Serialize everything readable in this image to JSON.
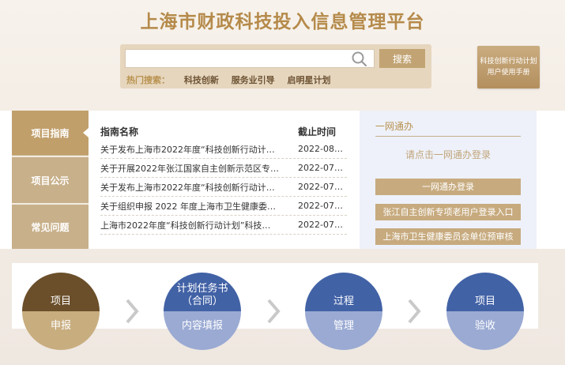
{
  "header": {
    "title": "上海市财政科技投入信息管理平台"
  },
  "search": {
    "placeholder": "",
    "button_label": "搜索",
    "hot_label": "热门搜索：",
    "hot_links": [
      "科技创新",
      "服务业引导",
      "启明星计划"
    ]
  },
  "manual": {
    "line1": "科技创新行动计划",
    "line2": "用户使用手册"
  },
  "tabs": [
    {
      "label": "项目指南",
      "active": true
    },
    {
      "label": "项目公示",
      "active": false
    },
    {
      "label": "常见问题",
      "active": false
    }
  ],
  "guide": {
    "col_name": "指南名称",
    "col_date": "截止时间",
    "rows": [
      {
        "name": "关于发布上海市2022年度“科技创新行动计…",
        "date": "2022-08…"
      },
      {
        "name": "关于开展2022年张江国家自主创新示范区专…",
        "date": "2022-07…"
      },
      {
        "name": "关于发布上海市2022年度“科技创新行动计…",
        "date": "2022-07…"
      },
      {
        "name": "关于组织申报 2022 年度上海市卫生健康委…",
        "date": "2022-07…"
      },
      {
        "name": "上海市2022年度“科技创新行动计划”科技…",
        "date": "2022-07…"
      }
    ]
  },
  "login": {
    "title": "一网通办",
    "hint": "请点击一网通办登录",
    "buttons": [
      "一网通办登录",
      "张江自主创新专项老用户登录入口",
      "上海市卫生健康委员会单位预审核"
    ]
  },
  "flow": {
    "steps": [
      {
        "top": "项目",
        "bottom": "申报",
        "top_color": "#6b4f2a",
        "bottom_color": "#c8ad7f"
      },
      {
        "top": "计划任务书\n（合同）",
        "bottom": "内容填报",
        "top_color": "#4262a6",
        "bottom_color": "#9aaad3"
      },
      {
        "top": "过程",
        "bottom": "管理",
        "top_color": "#4262a6",
        "bottom_color": "#9aaad3"
      },
      {
        "top": "项目",
        "bottom": "验收",
        "top_color": "#4262a6",
        "bottom_color": "#9aaad3"
      }
    ]
  },
  "colors": {
    "gold": "#b58a4a",
    "tan": "#c8b08a",
    "navy": "#4262a6"
  }
}
